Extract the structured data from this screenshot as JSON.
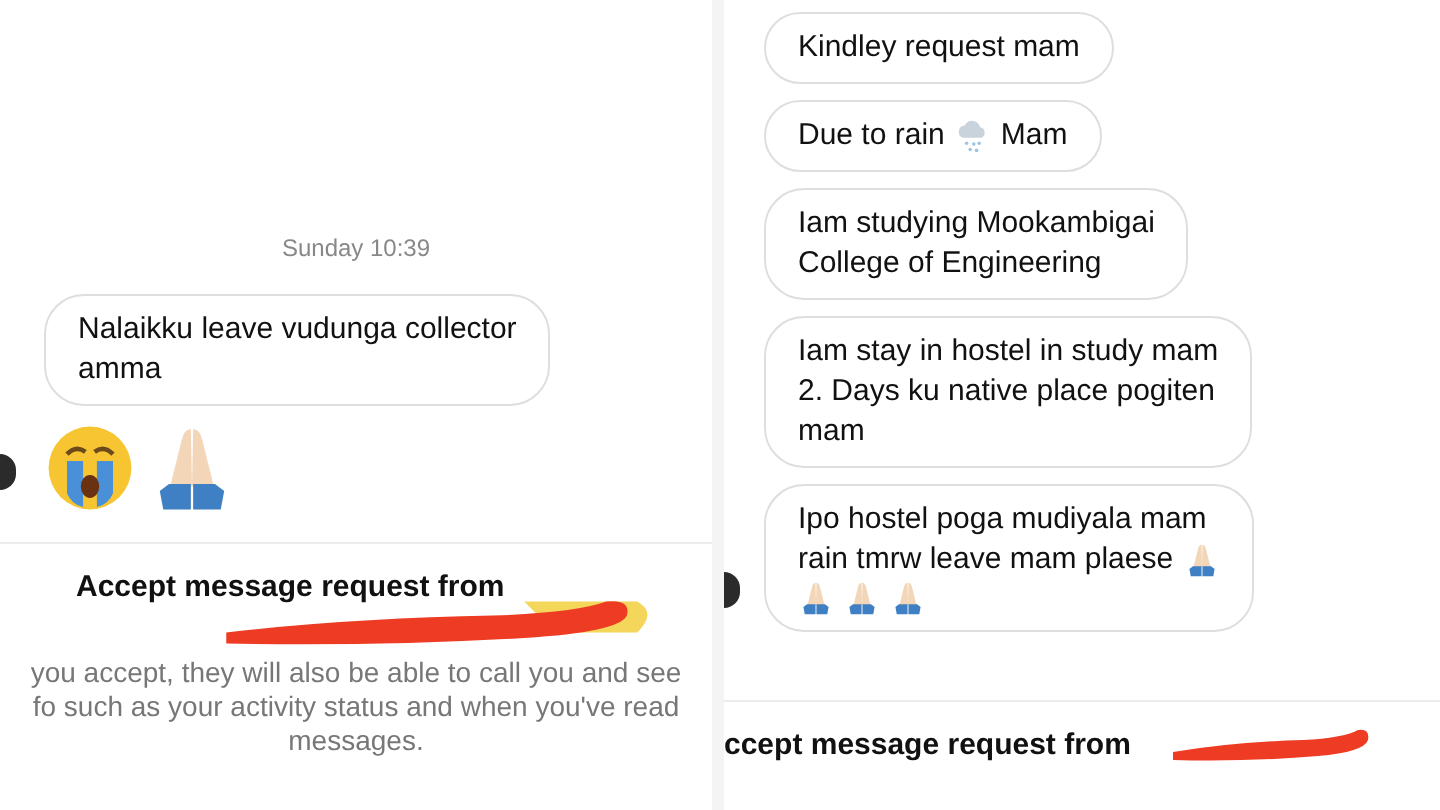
{
  "panels": [
    {
      "timestamp": "Sunday 10:39",
      "messages": [
        {
          "kind": "bubble",
          "avatar": false,
          "lines": [
            [
              {
                "kind": "text",
                "text": "Nalaikku leave vudunga collector"
              }
            ],
            [
              {
                "kind": "text",
                "text": "amma"
              }
            ]
          ]
        },
        {
          "kind": "emoji",
          "avatar": true,
          "lines": [
            [
              {
                "kind": "crying-face"
              },
              {
                "kind": "praying-hands"
              }
            ]
          ]
        }
      ],
      "request": {
        "title": "Accept message request from",
        "redacted": true,
        "highlight": true,
        "lines": [
          "you accept, they will also be able to call you and see",
          "fo such as your activity status and when you've read",
          "messages."
        ]
      }
    },
    {
      "messages": [
        {
          "kind": "bubble",
          "avatar": false,
          "lines": [
            [
              {
                "kind": "text",
                "text": "Kindley request mam"
              }
            ]
          ]
        },
        {
          "kind": "bubble",
          "avatar": false,
          "lines": [
            [
              {
                "kind": "text",
                "text": "Due to rain"
              },
              {
                "kind": "snow-cloud"
              },
              {
                "kind": "text",
                "text": "Mam"
              }
            ]
          ]
        },
        {
          "kind": "bubble",
          "avatar": false,
          "lines": [
            [
              {
                "kind": "text",
                "text": "Iam studying Mookambigai"
              }
            ],
            [
              {
                "kind": "text",
                "text": "College of Engineering"
              }
            ]
          ]
        },
        {
          "kind": "bubble",
          "avatar": false,
          "lines": [
            [
              {
                "kind": "text",
                "text": "Iam stay in hostel in study mam"
              }
            ],
            [
              {
                "kind": "text",
                "text": "2. Days ku native place pogiten"
              }
            ],
            [
              {
                "kind": "text",
                "text": "mam"
              }
            ]
          ]
        },
        {
          "kind": "bubble",
          "avatar": true,
          "lines": [
            [
              {
                "kind": "text",
                "text": "Ipo hostel poga mudiyala mam"
              }
            ],
            [
              {
                "kind": "text",
                "text": "rain tmrw leave mam plaese"
              },
              {
                "kind": "praying-hands"
              }
            ],
            [
              {
                "kind": "praying-hands"
              },
              {
                "kind": "praying-hands"
              },
              {
                "kind": "praying-hands"
              }
            ]
          ]
        }
      ],
      "request": {
        "title": "ccept message request from",
        "redacted": true,
        "highlight": false
      }
    }
  ]
}
